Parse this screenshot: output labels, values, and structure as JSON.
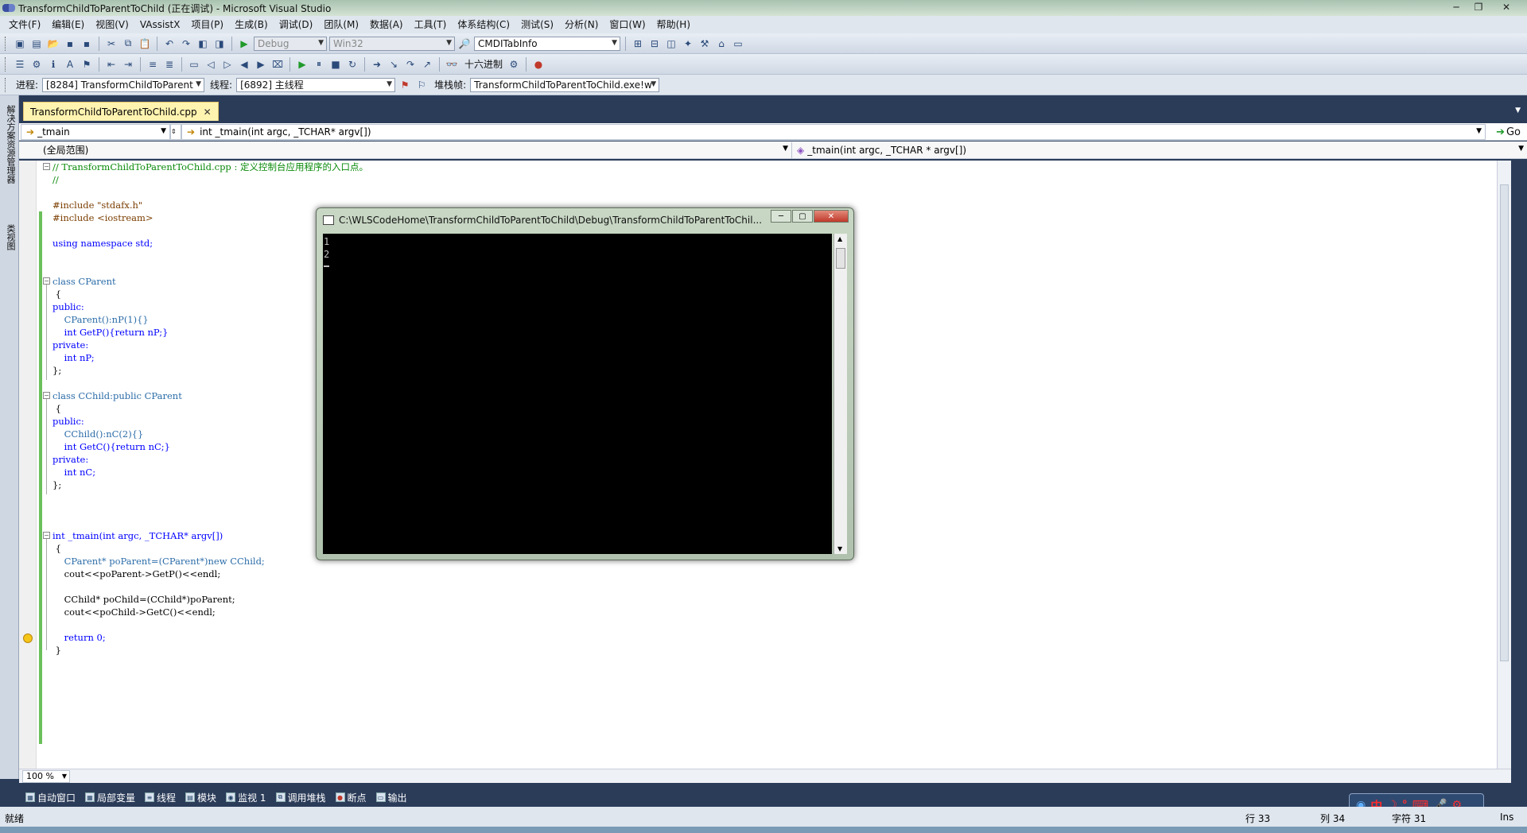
{
  "window": {
    "title": "TransformChildToParentToChild (正在调试) - Microsoft Visual Studio"
  },
  "menu": [
    "文件(F)",
    "编辑(E)",
    "视图(V)",
    "VAssistX",
    "项目(P)",
    "生成(B)",
    "调试(D)",
    "团队(M)",
    "数据(A)",
    "工具(T)",
    "体系结构(C)",
    "测试(S)",
    "分析(N)",
    "窗口(W)",
    "帮助(H)"
  ],
  "toolbar1": {
    "config": "Debug",
    "platform": "Win32",
    "find": "CMDITabInfo"
  },
  "toolbar2": {
    "hex_label": "十六进制"
  },
  "toolbar3": {
    "process_label": "进程:",
    "process_value": "[8284] TransformChildToParent",
    "thread_label": "线程:",
    "thread_value": "[6892] 主线程",
    "stack_label": "堆栈帧:",
    "stack_value": "TransformChildToParentToChild.exe!w"
  },
  "sidebar": {
    "solution_explorer": "解决方案资源管理器",
    "class_view": "类视图"
  },
  "doc_tab": {
    "label": "TransformChildToParentToChild.cpp"
  },
  "nav": {
    "symbol": "_tmain",
    "signature": "int _tmain(int argc, _TCHAR* argv[])",
    "go": "Go",
    "scope": "(全局范围)",
    "member": "_tmain(int argc, _TCHAR * argv[])"
  },
  "code_lines": [
    "// TransformChildToParentToChild.cpp : 定义控制台应用程序的入口点。",
    "//",
    "",
    "#include \"stdafx.h\"",
    "#include <iostream>",
    "",
    "using namespace std;",
    "",
    "",
    "class CParent",
    " {",
    "public:",
    "    CParent():nP(1){}",
    "    int GetP(){return nP;}",
    "private:",
    "    int nP;",
    "};",
    "",
    "class CChild:public CParent",
    " {",
    "public:",
    "    CChild():nC(2){}",
    "    int GetC(){return nC;}",
    "private:",
    "    int nC;",
    "};",
    "",
    "",
    "",
    "int _tmain(int argc, _TCHAR* argv[])",
    " {",
    "    CParent* poParent=(CParent*)new CChild;",
    "    cout<<poParent->GetP()<<endl;",
    "",
    "    CChild* poChild=(CChild*)poParent;",
    "    cout<<poChild->GetC()<<endl;",
    "",
    "    return 0;",
    " }"
  ],
  "editor": {
    "zoom": "100 %"
  },
  "console": {
    "title": "C:\\WLSCodeHome\\TransformChildToParentToChild\\Debug\\TransformChildToParentToChil...",
    "lines": [
      "1",
      "2"
    ]
  },
  "bottom_tabs": [
    "自动窗口",
    "局部变量",
    "线程",
    "模块",
    "监视 1",
    "调用堆栈",
    "断点",
    "输出"
  ],
  "status": {
    "ready": "就绪",
    "line": "行 33",
    "col": "列 34",
    "char": "字符 31",
    "ins": "Ins"
  },
  "ime": {
    "zh": "中"
  }
}
